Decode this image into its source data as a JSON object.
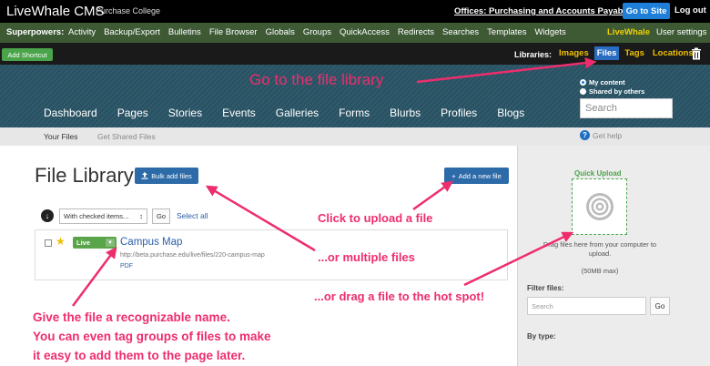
{
  "topbar": {
    "brand": "LiveWhale CMS",
    "brand_sub": "Purchase College",
    "offices_link": "Offices: Purchasing and Accounts Payable",
    "go_to_site": "Go to Site",
    "logout": "Log out"
  },
  "superpowers": {
    "label": "Superpowers:",
    "items": [
      "Activity",
      "Backup/Export",
      "Bulletins",
      "File Browser",
      "Globals",
      "Groups",
      "QuickAccess",
      "Redirects",
      "Searches",
      "Templates",
      "Widgets"
    ],
    "livewhale": "LiveWhale",
    "user_settings": "User settings"
  },
  "shortcut_bar": {
    "add_shortcut": "Add Shortcut",
    "libraries_label": "Libraries:",
    "libraries": [
      "Images",
      "Files",
      "Tags",
      "Locations"
    ],
    "active_library": "Files"
  },
  "nav": {
    "items": [
      "Dashboard",
      "Pages",
      "Stories",
      "Events",
      "Galleries",
      "Forms",
      "Blurbs",
      "Profiles",
      "Blogs"
    ],
    "scope_options": [
      "My content",
      "Shared by others"
    ],
    "search_placeholder": "Search"
  },
  "subnav": {
    "your_files": "Your Files",
    "shared_files": "Get Shared Files",
    "help": "Get help"
  },
  "main": {
    "title": "File Library",
    "bulk_add": "Bulk add files",
    "add_new": "Add a new file",
    "bulk_action": "With checked items...",
    "go": "Go",
    "select_all": "Select all",
    "file": {
      "status": "Live",
      "name": "Campus Map",
      "url": "http://beta.purchase.edu/live/files/220-campus-map",
      "type": "PDF"
    }
  },
  "sidebar": {
    "quick_upload": "Quick Upload",
    "drop_text": "Drag files here from your computer to upload.",
    "max_size": "(50MB max)",
    "filter_label": "Filter files:",
    "filter_placeholder": "Search",
    "filter_go": "Go",
    "by_type": "By type:"
  },
  "annotations": {
    "file_library": "Go to the file library",
    "upload": "Click to upload a file",
    "multiple": "...or multiple files",
    "drag": "...or drag a file to the hot spot!",
    "name_lines": [
      "Give the file a recognizable name.",
      "You can even tag groups of files to make",
      "it easy to add them to the page later."
    ]
  },
  "colors": {
    "annotation": "#ee2d6d",
    "primary_button": "#2d6aa8",
    "go_to_site": "#1e7ed8",
    "superbar": "#3d5a35",
    "live_badge": "#5aa54a",
    "library_link": "#f0c000"
  }
}
